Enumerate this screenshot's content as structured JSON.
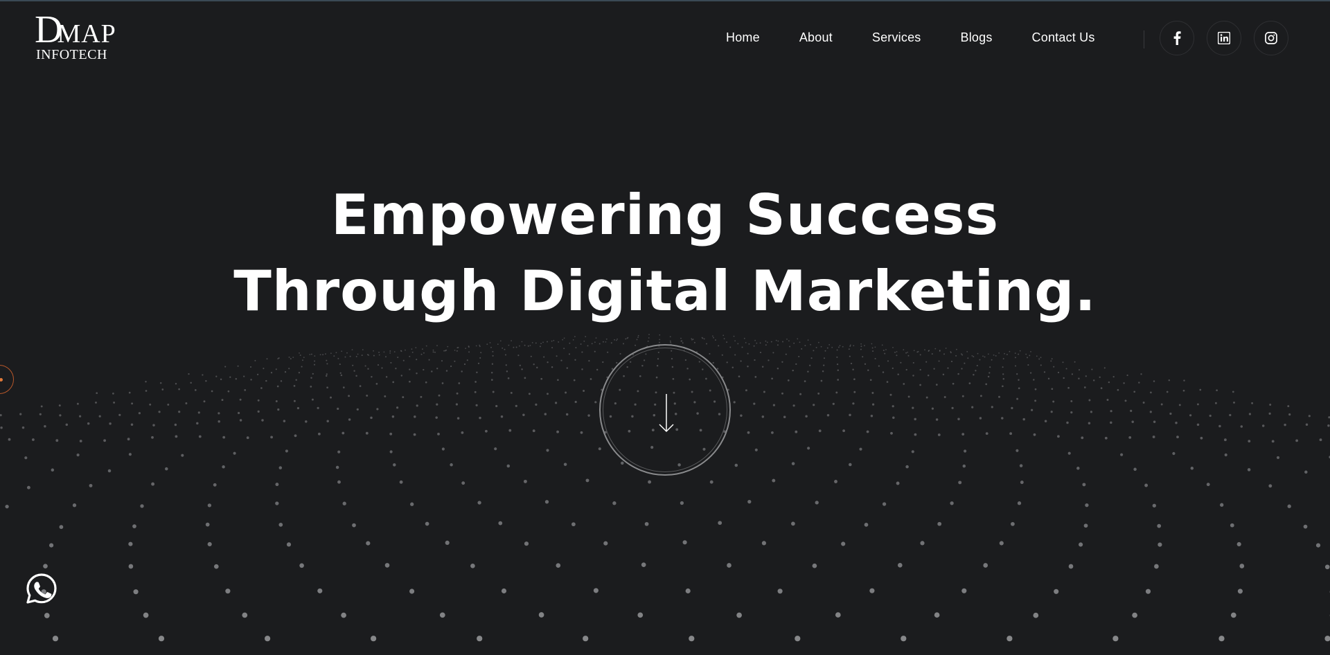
{
  "brand": {
    "logo_top": "DMAP",
    "logo_big_letter": "D",
    "logo_rest": "MAP",
    "logo_bottom": "INFOTECH"
  },
  "nav": {
    "items": [
      {
        "label": "Home"
      },
      {
        "label": "About"
      },
      {
        "label": "Services"
      },
      {
        "label": "Blogs"
      },
      {
        "label": "Contact Us"
      }
    ]
  },
  "social": {
    "icons": [
      "facebook-icon",
      "linkedin-icon",
      "instagram-icon"
    ]
  },
  "hero": {
    "line1": "Empowering Success",
    "line2": "Through Digital Marketing."
  },
  "colors": {
    "background": "#1b1c1e",
    "text": "#ffffff",
    "accent": "#e07a3a",
    "particle": "#9a9b9e"
  },
  "icons": {
    "scroll": "arrow-down-icon",
    "chat": "whatsapp-icon"
  }
}
